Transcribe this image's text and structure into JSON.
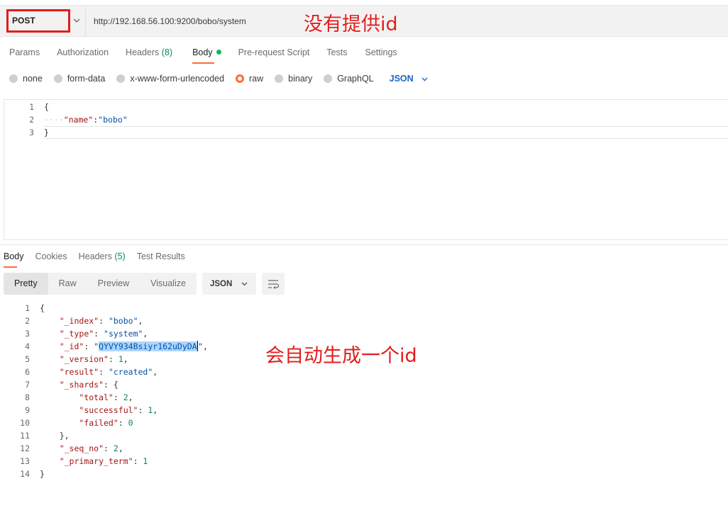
{
  "request": {
    "method": "POST",
    "url": "http://192.168.56.100:9200/bobo/system"
  },
  "annotations": {
    "no_id": "没有提供id",
    "auto_id": "会自动生成一个id",
    "color": "#e31c1c"
  },
  "request_tabs": [
    {
      "label": "Params"
    },
    {
      "label": "Authorization"
    },
    {
      "label": "Headers",
      "count": "(8)"
    },
    {
      "label": "Body"
    },
    {
      "label": "Pre-request Script"
    },
    {
      "label": "Tests"
    },
    {
      "label": "Settings"
    }
  ],
  "body_types": [
    "none",
    "form-data",
    "x-www-form-urlencoded",
    "raw",
    "binary",
    "GraphQL"
  ],
  "body_language": "JSON",
  "request_body": {
    "line_numbers": [
      "1",
      "2",
      "3"
    ],
    "open_brace": "{",
    "indent_dots": "····",
    "key": "\"name\"",
    "colon": ":",
    "value": "\"bobo\"",
    "close_brace": "}"
  },
  "response_tabs": [
    {
      "label": "Body"
    },
    {
      "label": "Cookies"
    },
    {
      "label": "Headers",
      "count": "(5)"
    },
    {
      "label": "Test Results"
    }
  ],
  "view_modes": [
    "Pretty",
    "Raw",
    "Preview",
    "Visualize"
  ],
  "response_format": "JSON",
  "response_body": {
    "line_numbers": [
      "1",
      "2",
      "3",
      "4",
      "5",
      "6",
      "7",
      "8",
      "9",
      "10",
      "11",
      "12",
      "13",
      "14"
    ],
    "open_brace": "{",
    "index_key": "\"_index\"",
    "index_val": "\"bobo\"",
    "type_key": "\"_type\"",
    "type_val": "\"system\"",
    "id_key": "\"_id\"",
    "id_val": "QYVY934Bsiyr162uDyDA",
    "version_key": "\"_version\"",
    "version_val": "1",
    "result_key": "\"result\"",
    "result_val": "\"created\"",
    "shards_key": "\"_shards\"",
    "total_key": "\"total\"",
    "total_val": "2",
    "successful_key": "\"successful\"",
    "successful_val": "1",
    "failed_key": "\"failed\"",
    "failed_val": "0",
    "shards_close": "},",
    "seq_key": "\"_seq_no\"",
    "seq_val": "2",
    "term_key": "\"_primary_term\"",
    "term_val": "1",
    "close_brace": "}"
  }
}
